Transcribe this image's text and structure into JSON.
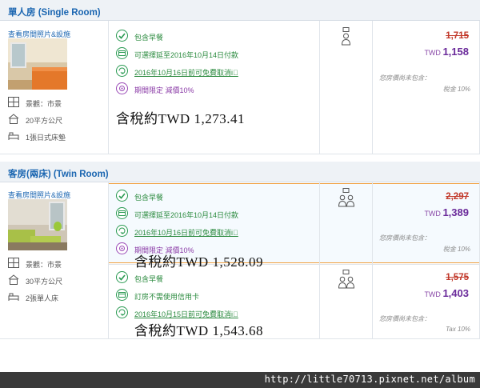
{
  "rooms": [
    {
      "title": "單人房 (Single Room)",
      "photo_link": "查看房間照片&設施",
      "info": [
        "景觀：市景",
        "20平方公尺",
        "1張日式床墊"
      ],
      "offers": [
        {
          "features": [
            "包含早餐",
            "可選擇延至2016年10月14日付款",
            "2016年10月16日前可免費取消i⃝",
            "期間限定 減價10%"
          ],
          "handwritten": "含稅約TWD  1,273.41",
          "old_price": "1,715",
          "currency": "TWD",
          "new_price": "1,158",
          "note1": "您房價尚未包含：",
          "note2": "稅金 10%"
        }
      ]
    },
    {
      "title": "客房(兩床) (Twin Room)",
      "photo_link": "查看房間照片&設施",
      "info": [
        "景觀：市景",
        "30平方公尺",
        "2張單人床"
      ],
      "offers": [
        {
          "features": [
            "包含早餐",
            "可選擇延至2016年10月14日付款",
            "2016年10月16日前可免費取消i⃝",
            "期間限定 減價10%"
          ],
          "handwritten": "含稅約TWD  1,528.09",
          "old_price": "2,297",
          "currency": "TWD",
          "new_price": "1,389",
          "note1": "您房價尚未包含：",
          "note2": "稅金 10%"
        },
        {
          "features": [
            "包含早餐",
            "訂房不需使用信用卡",
            "2016年10月15日前可免費取消i⃝"
          ],
          "handwritten": "含稅約TWD  1,543.68",
          "old_price": "1,575",
          "currency": "TWD",
          "new_price": "1,403",
          "note1": "您房價尚未包含：",
          "note2": "Tax 10%"
        }
      ]
    }
  ],
  "footer_url": "http://little70713.pixnet.net/album",
  "colors": {
    "accent_blue": "#1b66b1",
    "green": "#2a9a52",
    "purple": "#6a2a9a",
    "strike_red": "#c23a2c",
    "highlight": "#f0a040"
  }
}
